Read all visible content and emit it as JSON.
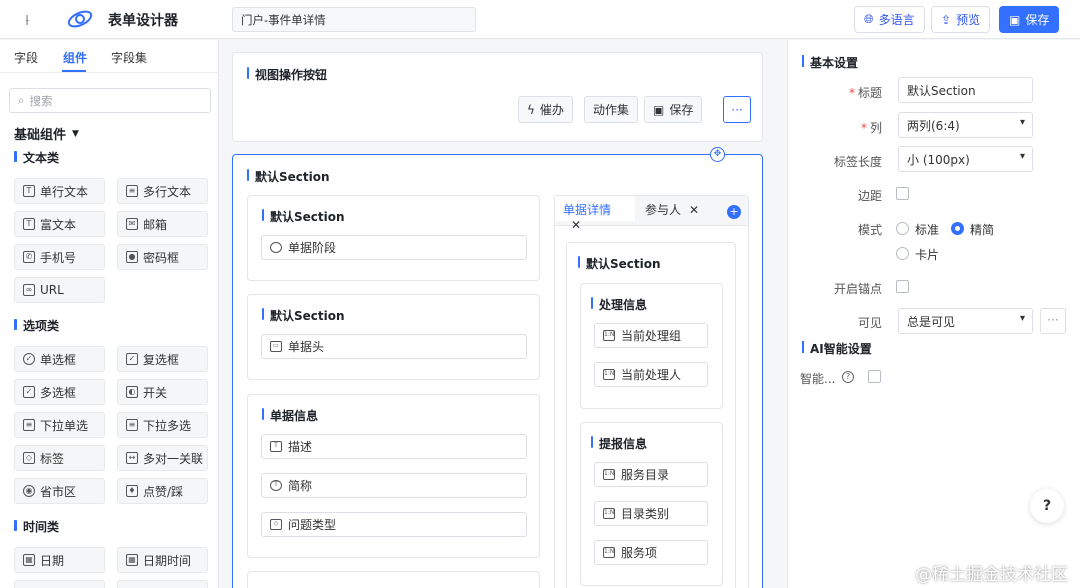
{
  "topbar": {
    "title": "表单设计器",
    "form_name": "门户-事件单详情",
    "lang_btn": "多语言",
    "preview_btn": "预览",
    "save_btn": "保存"
  },
  "left": {
    "tabs": [
      "字段",
      "组件",
      "字段集"
    ],
    "search_placeholder": "搜索",
    "group": "基础组件",
    "categories": {
      "text": "文本类",
      "option": "选项类",
      "time": "时间类"
    },
    "text_items": [
      "单行文本",
      "多行文本",
      "富文本",
      "邮箱",
      "手机号",
      "密码框",
      "URL"
    ],
    "option_items": [
      "单选框",
      "复选框",
      "多选框",
      "开关",
      "下拉单选",
      "下拉多选",
      "标签",
      "多对一关联",
      "省市区",
      "点赞/踩"
    ],
    "time_items": [
      "日期",
      "日期时间"
    ]
  },
  "canvas": {
    "view_ops": {
      "title": "视图操作按钮",
      "btn_urge": "催办",
      "btn_actions": "动作集",
      "btn_save": "保存",
      "btn_more": "···"
    },
    "section": {
      "title": "默认Section",
      "sub1": {
        "title": "默认Section",
        "field": "单据阶段"
      },
      "sub2": {
        "title": "默认Section",
        "field": "单据头"
      },
      "sub3": {
        "title": "单据信息",
        "fields": [
          "描述",
          "简称",
          "问题类型"
        ]
      },
      "tabs": [
        "单据详情",
        "参与人"
      ],
      "tab_section": {
        "title": "默认Section",
        "handle": {
          "title": "处理信息",
          "fields": [
            "当前处理组",
            "当前处理人"
          ]
        },
        "report": {
          "title": "提报信息",
          "fields": [
            "服务目录",
            "目录类别",
            "服务项"
          ]
        }
      }
    }
  },
  "right": {
    "basic_title": "基本设置",
    "labels": {
      "title": "标题",
      "columns": "列",
      "label_width": "标签长度",
      "margin": "边距",
      "mode": "模式",
      "anchor": "开启锚点",
      "visible": "可见",
      "smart": "智能..."
    },
    "values": {
      "title": "默认Section",
      "columns": "两列(6:4)",
      "label_width": "小 (100px)",
      "visible": "总是可见",
      "visible_more": "···"
    },
    "modes": [
      "标准",
      "精简",
      "卡片"
    ],
    "ai_title": "AI智能设置",
    "help": "?"
  },
  "watermark": "@稀土掘金技术社区"
}
